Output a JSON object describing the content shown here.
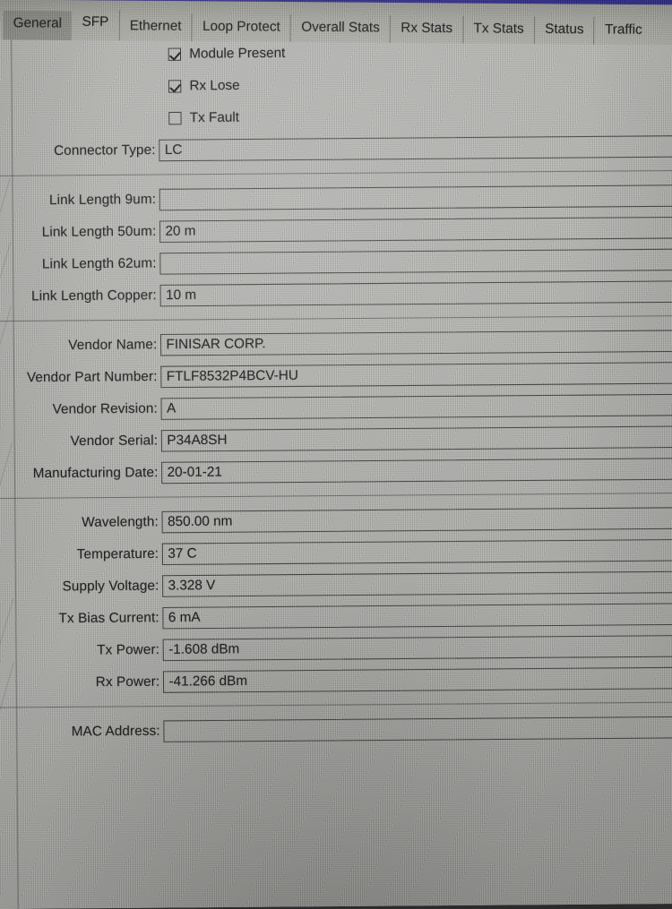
{
  "window": {
    "titlebar_color": "#241f80",
    "panel_color": "#b5b5b2"
  },
  "tabs": [
    {
      "label": "General",
      "state": "hovered"
    },
    {
      "label": "SFP",
      "state": "active"
    },
    {
      "label": "Ethernet",
      "state": "normal"
    },
    {
      "label": "Loop Protect",
      "state": "normal"
    },
    {
      "label": "Overall Stats",
      "state": "normal"
    },
    {
      "label": "Rx Stats",
      "state": "normal"
    },
    {
      "label": "Tx Stats",
      "state": "normal"
    },
    {
      "label": "Status",
      "state": "normal"
    },
    {
      "label": "Traffic",
      "state": "normal"
    }
  ],
  "checkboxes": [
    {
      "label": "Module Present",
      "checked": true
    },
    {
      "label": "Rx Lose",
      "checked": true
    },
    {
      "label": "Tx Fault",
      "checked": false
    }
  ],
  "connector": {
    "type_label": "Connector Type:",
    "type_value": "LC"
  },
  "link_length": {
    "l9um_label": "Link Length 9um:",
    "l9um_value": "",
    "l50um_label": "Link Length 50um:",
    "l50um_value": "20 m",
    "l62um_label": "Link Length 62um:",
    "l62um_value": "",
    "copper_label": "Link Length Copper:",
    "copper_value": "10 m"
  },
  "vendor": {
    "name_label": "Vendor Name:",
    "name_value": "FINISAR CORP.",
    "part_label": "Vendor Part Number:",
    "part_value": "FTLF8532P4BCV-HU",
    "revision_label": "Vendor Revision:",
    "revision_value": "A",
    "serial_label": "Vendor Serial:",
    "serial_value": "P34A8SH",
    "mfg_date_label": "Manufacturing Date:",
    "mfg_date_value": "20-01-21"
  },
  "diagnostics": {
    "wavelength_label": "Wavelength:",
    "wavelength_value": "850.00 nm",
    "temperature_label": "Temperature:",
    "temperature_value": "37 C",
    "voltage_label": "Supply Voltage:",
    "voltage_value": "3.328 V",
    "tx_bias_label": "Tx Bias Current:",
    "tx_bias_value": "6 mA",
    "tx_power_label": "Tx Power:",
    "tx_power_value": "-1.608 dBm",
    "rx_power_label": "Rx Power:",
    "rx_power_value": "-41.266 dBm"
  },
  "mac": {
    "label": "MAC Address:",
    "value": ""
  }
}
